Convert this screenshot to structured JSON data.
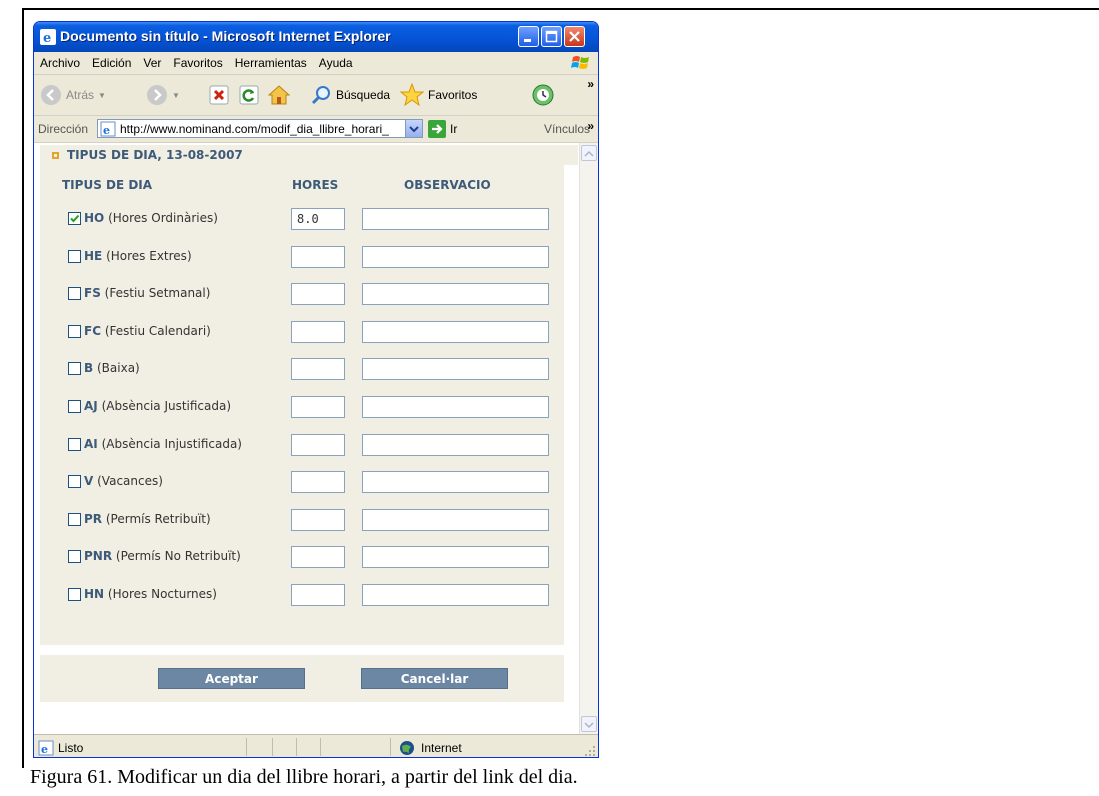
{
  "window": {
    "title": "Documento sin título - Microsoft Internet Explorer"
  },
  "menu": [
    "Archivo",
    "Edición",
    "Ver",
    "Favoritos",
    "Herramientas",
    "Ayuda"
  ],
  "toolbar": {
    "back": "Atrás",
    "search": "Búsqueda",
    "favorites": "Favoritos",
    "overflow": "»"
  },
  "address": {
    "label": "Dirección",
    "url": "http://www.nominand.com/modif_dia_llibre_horari_",
    "go": "Ir",
    "links": "Vínculos",
    "overflow": "»"
  },
  "section": {
    "title": "TIPUS DE DIA, 13-08-2007"
  },
  "table": {
    "headers": {
      "type": "TIPUS DE DIA",
      "hours": "HORES",
      "notes": "OBSERVACIO"
    },
    "rows": [
      {
        "code": "HO",
        "desc": "(Hores Ordinàries)",
        "checked": true,
        "hours": "8.0",
        "notes": ""
      },
      {
        "code": "HE",
        "desc": "(Hores Extres)",
        "checked": false,
        "hours": "",
        "notes": ""
      },
      {
        "code": "FS",
        "desc": "(Festiu Setmanal)",
        "checked": false,
        "hours": "",
        "notes": ""
      },
      {
        "code": "FC",
        "desc": "(Festiu Calendari)",
        "checked": false,
        "hours": "",
        "notes": ""
      },
      {
        "code": "B",
        "desc": "(Baixa)",
        "checked": false,
        "hours": "",
        "notes": ""
      },
      {
        "code": "AJ",
        "desc": "(Absència Justificada)",
        "checked": false,
        "hours": "",
        "notes": ""
      },
      {
        "code": "AI",
        "desc": "(Absència Injustificada)",
        "checked": false,
        "hours": "",
        "notes": ""
      },
      {
        "code": "V",
        "desc": "(Vacances)",
        "checked": false,
        "hours": "",
        "notes": ""
      },
      {
        "code": "PR",
        "desc": "(Permís Retribuït)",
        "checked": false,
        "hours": "",
        "notes": ""
      },
      {
        "code": "PNR",
        "desc": "(Permís No Retribuït)",
        "checked": false,
        "hours": "",
        "notes": ""
      },
      {
        "code": "HN",
        "desc": "(Hores Nocturnes)",
        "checked": false,
        "hours": "",
        "notes": ""
      }
    ]
  },
  "buttons": {
    "accept": "Aceptar",
    "cancel": "Cancel·lar"
  },
  "status": {
    "text": "Listo",
    "zone": "Internet"
  },
  "caption": "Figura 61. Modificar un dia del llibre horari, a partir del link del dia.",
  "colors": {
    "accent": "#3d5a78",
    "button": "#6c87a3",
    "panel": "#f1efe3",
    "titlebar": "#0553d6"
  }
}
